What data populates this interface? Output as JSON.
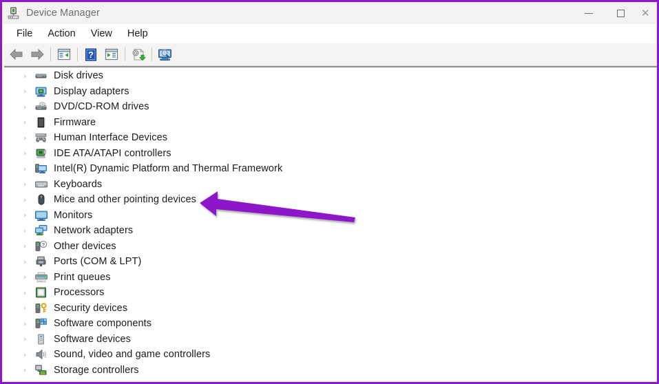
{
  "window": {
    "title": "Device Manager",
    "icon": "device-manager-icon",
    "border_color": "#8d17c9",
    "titlebar_bg": "#f3f2f1",
    "caption_buttons": [
      {
        "name": "minimize",
        "glyph": "—"
      },
      {
        "name": "maximize",
        "glyph": "□"
      },
      {
        "name": "close",
        "glyph": "✕"
      }
    ]
  },
  "menubar": {
    "items": [
      {
        "label": "File",
        "name": "menu-file"
      },
      {
        "label": "Action",
        "name": "menu-action"
      },
      {
        "label": "View",
        "name": "menu-view"
      },
      {
        "label": "Help",
        "name": "menu-help"
      }
    ]
  },
  "toolbar": {
    "buttons": [
      {
        "name": "back-button",
        "icon": "back-arrow-icon"
      },
      {
        "name": "forward-button",
        "icon": "forward-arrow-icon"
      },
      {
        "name": "show-hide-console-tree-button",
        "icon": "console-tree-icon"
      },
      {
        "name": "help-button",
        "icon": "question-mark-icon"
      },
      {
        "name": "properties-button",
        "icon": "properties-pane-icon"
      },
      {
        "name": "update-driver-button",
        "icon": "update-driver-icon"
      },
      {
        "name": "scan-hardware-changes-button",
        "icon": "scan-monitor-icon"
      }
    ]
  },
  "tree": {
    "items": [
      {
        "label": "Disk drives",
        "icon": "disk-drive-icon",
        "expanded": false
      },
      {
        "label": "Display adapters",
        "icon": "display-adapter-icon",
        "expanded": false
      },
      {
        "label": "DVD/CD-ROM drives",
        "icon": "dvd-drive-icon",
        "expanded": false
      },
      {
        "label": "Firmware",
        "icon": "firmware-chip-icon",
        "expanded": false
      },
      {
        "label": "Human Interface Devices",
        "icon": "hid-gamepad-icon",
        "expanded": false
      },
      {
        "label": "IDE ATA/ATAPI controllers",
        "icon": "ide-controller-icon",
        "expanded": false
      },
      {
        "label": "Intel(R) Dynamic Platform and Thermal Framework",
        "icon": "thermal-framework-icon",
        "expanded": false
      },
      {
        "label": "Keyboards",
        "icon": "keyboard-icon",
        "expanded": false
      },
      {
        "label": "Mice and other pointing devices",
        "icon": "mouse-icon",
        "expanded": false
      },
      {
        "label": "Monitors",
        "icon": "monitor-icon",
        "expanded": false
      },
      {
        "label": "Network adapters",
        "icon": "network-adapter-icon",
        "expanded": false
      },
      {
        "label": "Other devices",
        "icon": "unknown-device-icon",
        "expanded": false
      },
      {
        "label": "Ports (COM & LPT)",
        "icon": "port-connector-icon",
        "expanded": false
      },
      {
        "label": "Print queues",
        "icon": "printer-icon",
        "expanded": false
      },
      {
        "label": "Processors",
        "icon": "processor-chip-icon",
        "expanded": false
      },
      {
        "label": "Security devices",
        "icon": "security-key-icon",
        "expanded": false
      },
      {
        "label": "Software components",
        "icon": "software-component-icon",
        "expanded": false
      },
      {
        "label": "Software devices",
        "icon": "software-device-icon",
        "expanded": false
      },
      {
        "label": "Sound, video and game controllers",
        "icon": "speaker-icon",
        "expanded": false
      },
      {
        "label": "Storage controllers",
        "icon": "storage-controller-icon",
        "expanded": false
      }
    ],
    "chevron_glyph": "›"
  },
  "annotation": {
    "type": "arrow",
    "color": "#8d17c9",
    "points_to": "Mice and other pointing devices",
    "direction": "left"
  }
}
